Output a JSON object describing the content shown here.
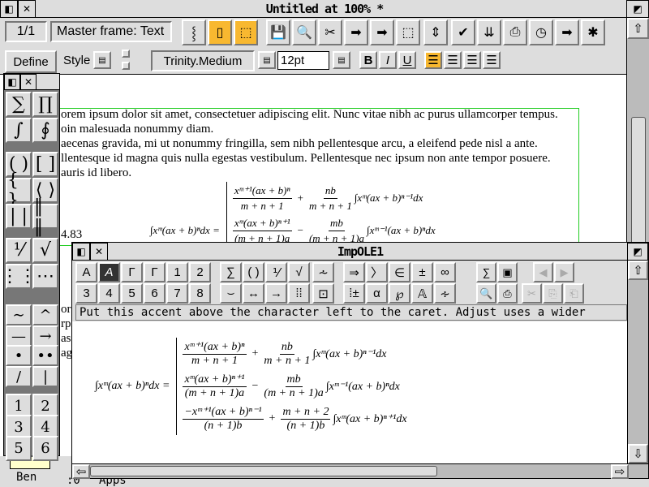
{
  "main_window": {
    "title": "Untitled at 100% *",
    "page": "1/1",
    "frame": "Master frame: Text",
    "toolbar_icons": [
      "text-frame-icon",
      "page-frame-icon",
      "picture-frame-icon",
      "save-icon",
      "find-icon",
      "cut-icon",
      "paste-icon",
      "copy-icon",
      "select-frame-icon",
      "line-spacing-icon",
      "spell-check-icon",
      "import-icon",
      "print-icon",
      "clock-icon",
      "export-icon",
      "colours-icon"
    ],
    "define_label": "Define",
    "style_label": "Style",
    "font": "Trinity.Medium",
    "size": "12pt",
    "bold": "B",
    "italic": "I",
    "underline": "U",
    "body_lines": [
      "orem ipsum dolor sit amet, consectetuer adipiscing elit. Nunc vitae nibh ac purus ullamcorper tempus.",
      "oin malesuada nonummy diam.",
      "aecenas gravida, mi ut nonummy fringilla, sem nibh pellentesque arcu, a eleifend pede nisl a ante.",
      "llentesque id magna quis nulla egestas vestibulum. Pellentesque nec ipsum non ante tempor posuere.",
      "auris id libero."
    ],
    "eq_number": "4.83",
    "behind_lines": [
      "ore",
      "rpi",
      "as",
      "ag"
    ]
  },
  "palette": {
    "symbols": [
      "∑",
      "∏",
      "∫",
      "∮",
      "( )",
      "[ ]",
      "{ }",
      "⟨ ⟩",
      "| |",
      "‖ ‖",
      "⅟",
      "√",
      "⋮⋮",
      "⋯",
      "⋰",
      "∼",
      "^",
      "—",
      "→",
      "•",
      "••",
      "/",
      "|",
      "1",
      "2",
      "3",
      "4",
      "5",
      "6"
    ]
  },
  "ole_window": {
    "title": "ImpOLE1",
    "toolbar_row1": [
      "A",
      "A",
      "Γ",
      "Γ",
      "1",
      "2",
      "∑",
      "( )",
      "⅟",
      "√",
      "⩪",
      "⇒",
      "〉",
      "∈",
      "±",
      "∞"
    ],
    "toolbar_row2": [
      "3",
      "4",
      "5",
      "6",
      "7",
      "8",
      "⌣",
      "↔",
      "→",
      "⁞⁞",
      "⊡",
      "⁞±",
      "α",
      "℘",
      "𝔸",
      "∻"
    ],
    "status": "Put this accent above the character left to the caret. Adjust uses a wider accent."
  },
  "formula": {
    "lhs": "∫xᵐ(ax + b)ⁿdx =",
    "rows": [
      {
        "n1": "xᵐ⁺¹(ax + b)ⁿ",
        "d1": "m + n + 1",
        "op": "+",
        "n2": "nb",
        "d2": "m + n + 1",
        "tail": "∫xᵐ(ax + b)ⁿ⁻¹dx"
      },
      {
        "n1": "xᵐ(ax + b)ⁿ⁺¹",
        "d1": "(m + n + 1)a",
        "op": "−",
        "n2": "mb",
        "d2": "(m + n + 1)a",
        "tail": "∫xᵐ⁻¹(ax + b)ⁿdx"
      },
      {
        "n1": "−xᵐ⁺¹(ax + b)ⁿ⁻¹",
        "d1": "(n + 1)b",
        "op": "+",
        "n2": "m + n + 2",
        "d2": "(n + 1)b",
        "tail": "∫xᵐ(ax + b)ⁿ⁺¹dx"
      }
    ]
  },
  "iconbar": {
    "items": [
      "Ben",
      ":0",
      "Apps"
    ]
  }
}
